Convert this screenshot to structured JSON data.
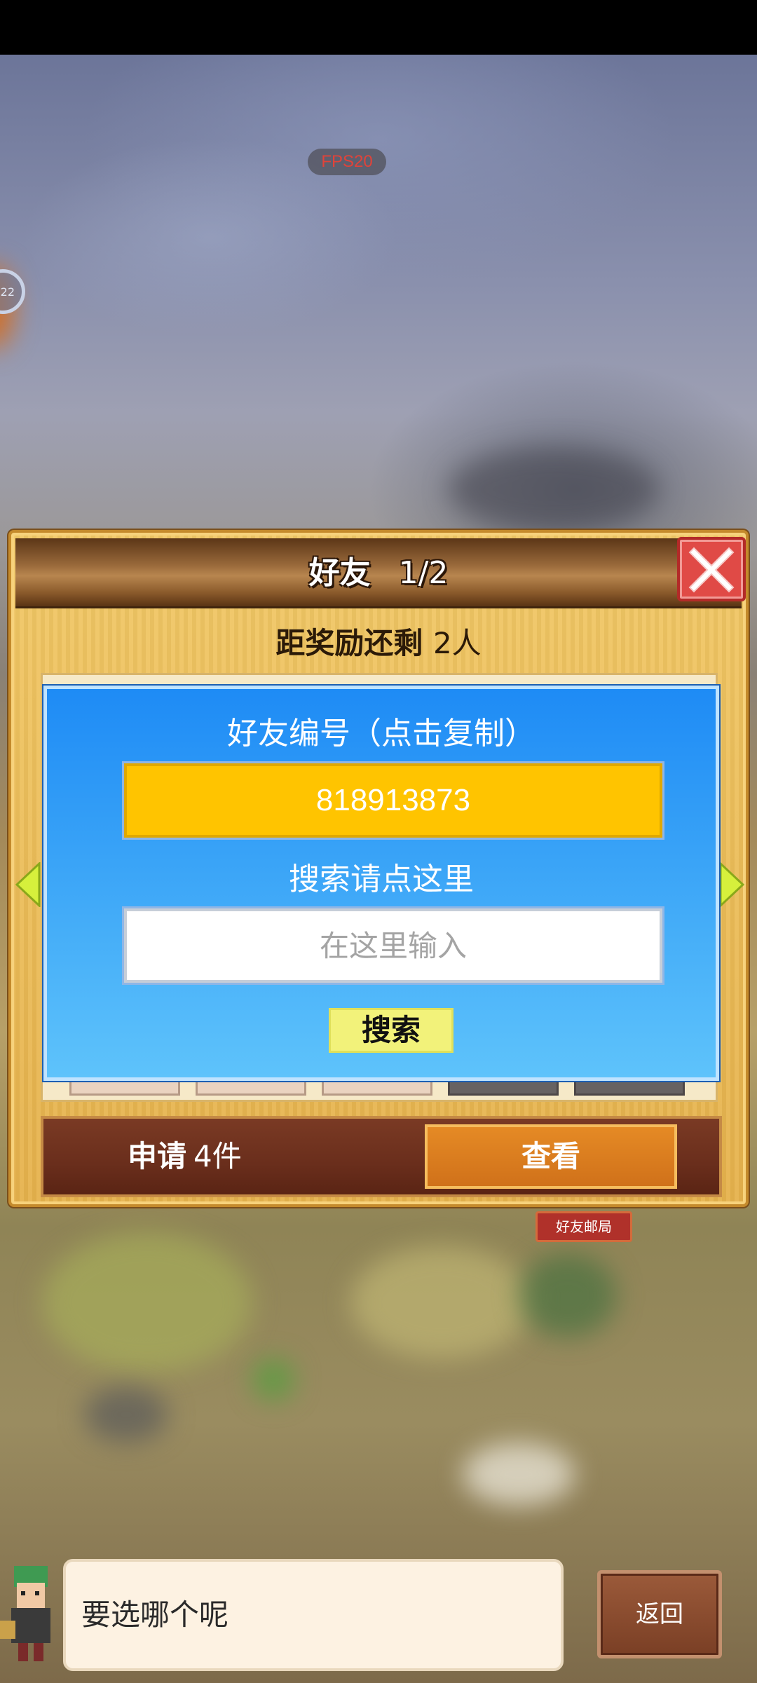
{
  "hud": {
    "fps_label": "FPS20",
    "circle_badge": "22"
  },
  "world": {
    "sign_label": "好友邮局"
  },
  "panel": {
    "title": "好友",
    "page": "1/2",
    "reward_prefix": "距奖励还剩",
    "reward_count": "2人"
  },
  "popup": {
    "title": "好友编号（点击复制）",
    "friend_id": "818913873",
    "search_hint": "搜索请点这里",
    "search_placeholder": "在这里输入",
    "search_button": "搜索"
  },
  "requests": {
    "label": "申请",
    "count": "4件",
    "view_button": "查看"
  },
  "bottom": {
    "speech": "要选哪个呢",
    "back_button": "返回"
  },
  "colors": {
    "panel_wood": "#e8b84f",
    "header_brown": "#8a5a2b",
    "popup_blue": "#3aa4f7",
    "id_box_yellow": "#ffc400",
    "search_btn": "#f2f27a",
    "view_btn_orange": "#e58a25",
    "close_red": "#e04a46"
  },
  "icons": [
    "close-icon",
    "left-arrow-icon",
    "right-arrow-icon"
  ]
}
